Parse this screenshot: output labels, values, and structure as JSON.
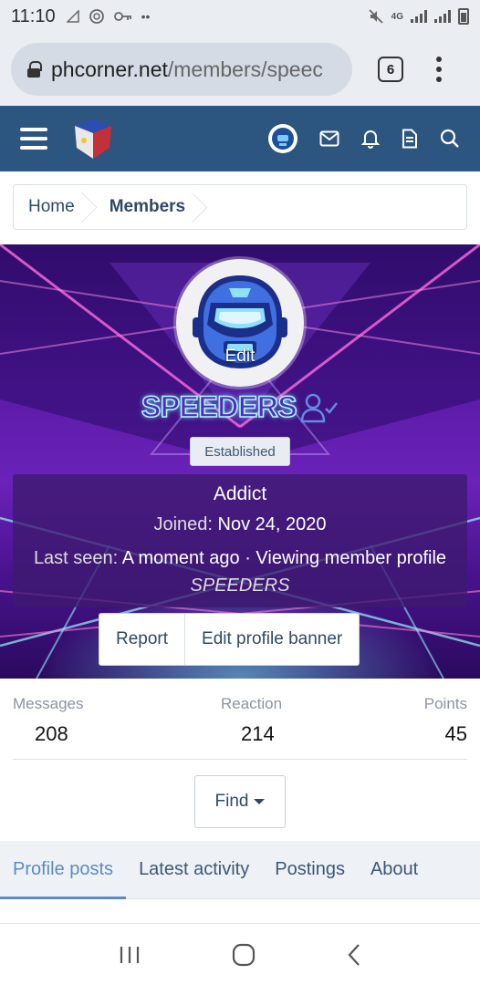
{
  "status": {
    "time": "11:10",
    "network": "4G"
  },
  "browser": {
    "url_host": "phcorner.net",
    "url_path": "/members/speec",
    "tab_count": "6"
  },
  "breadcrumb": [
    {
      "label": "Home"
    },
    {
      "label": "Members"
    }
  ],
  "profile": {
    "avatar_edit": "Edit",
    "username": "SPEEDERS",
    "badge": "Established",
    "title": "Addict",
    "joined_label": "Joined:",
    "joined_value": "Nov 24, 2020",
    "last_seen_label": "Last seen:",
    "last_seen_value": "A moment ago · Viewing member profile",
    "last_seen_target": "SPEEDERS"
  },
  "actions": {
    "report": "Report",
    "edit_banner": "Edit profile banner"
  },
  "stats": {
    "messages_label": "Messages",
    "messages_value": "208",
    "reaction_label": "Reaction",
    "reaction_value": "214",
    "points_label": "Points",
    "points_value": "45"
  },
  "find": {
    "label": "Find"
  },
  "tabs": [
    {
      "label": "Profile posts",
      "active": true
    },
    {
      "label": "Latest activity"
    },
    {
      "label": "Postings"
    },
    {
      "label": "About"
    }
  ],
  "colors": {
    "header": "#2c5580",
    "accent": "#5d8ac4",
    "banner": "#5a1aa6"
  },
  "icons": [
    "lock-icon",
    "hamburger-icon",
    "site-logo",
    "user-avatar-icon",
    "mail-icon",
    "bell-icon",
    "document-icon",
    "search-icon",
    "user-check-icon",
    "caret-down-icon",
    "recents-icon",
    "home-icon",
    "back-icon"
  ]
}
